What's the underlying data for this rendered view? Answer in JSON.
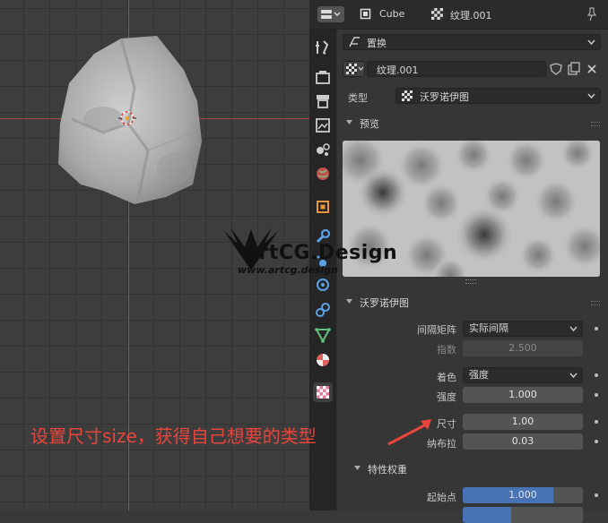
{
  "topbar": {
    "object_name": "Cube",
    "texture_name": "纹理.001"
  },
  "modifier": {
    "name": "置换"
  },
  "texture_slot": {
    "name": "纹理.001"
  },
  "type": {
    "label": "类型",
    "value": "沃罗诺伊图"
  },
  "preview_panel": {
    "title": "预览"
  },
  "voronoi_panel": {
    "title": "沃罗诺伊图",
    "distance_metric": {
      "label": "间隔矩阵",
      "value": "实际间隔"
    },
    "exponent": {
      "label": "指数",
      "value": "2.500"
    },
    "coloring": {
      "label": "着色",
      "value": "强度"
    },
    "intensity": {
      "label": "强度",
      "value": "1.000"
    },
    "size": {
      "label": "尺寸",
      "value": "1.00"
    },
    "nabla": {
      "label": "纳布拉",
      "value": "0.03"
    }
  },
  "feature_weights_panel": {
    "title": "特性权重",
    "weight1": {
      "label": "起始点",
      "value": "1.000",
      "fill": 0.75
    }
  },
  "watermark": {
    "title": "ArtCG.Design",
    "subtitle": "www.artcg.design"
  },
  "annotation": {
    "text": "设置尺寸size，获得自己想要的类型"
  },
  "colors": {
    "accent_blue": "#4772b3",
    "annotation_red": "#e8453c",
    "x_axis": "#a3434b",
    "y_axis": "#3f6e9a"
  }
}
